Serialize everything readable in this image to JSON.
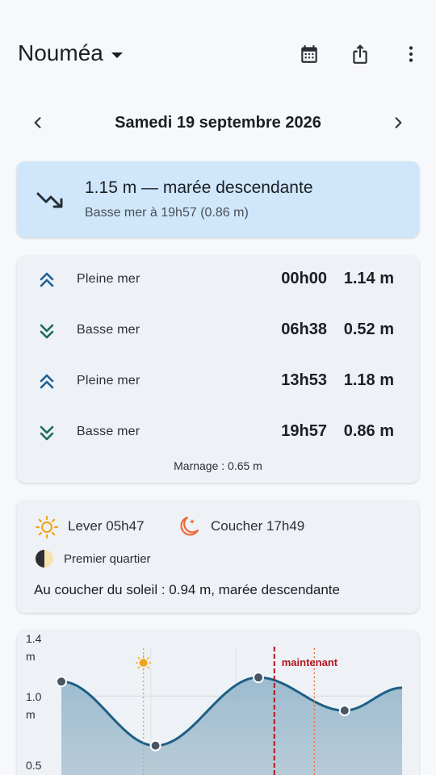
{
  "header": {
    "city": "Nouméa",
    "icons": {
      "calendar": "calendar-icon",
      "share": "share-icon",
      "menu": "more-vert-icon"
    }
  },
  "date_nav": {
    "prev_icon": "chevron-left-icon",
    "title": "Samedi 19 septembre 2026",
    "next_icon": "chevron-right-icon"
  },
  "status": {
    "icon": "trending-down-icon",
    "current": "1.15 m — marée descendante",
    "next": "Basse mer à 19h57 (0.86 m)"
  },
  "tides": {
    "rows": [
      {
        "type": "high",
        "label": "Pleine mer",
        "time": "00h00",
        "height": "1.14 m"
      },
      {
        "type": "low",
        "label": "Basse mer",
        "time": "06h38",
        "height": "0.52 m"
      },
      {
        "type": "high",
        "label": "Pleine mer",
        "time": "13h53",
        "height": "1.18 m"
      },
      {
        "type": "low",
        "label": "Basse mer",
        "time": "19h57",
        "height": "0.86 m"
      }
    ],
    "marnage": "Marnage : 0.65 m"
  },
  "sun": {
    "rise": "Lever 05h47",
    "set": "Coucher 17h49",
    "moon_phase": "Premier quartier",
    "sunset_tide": "Au coucher du soleil : 0.94 m, marée descendante"
  },
  "colors": {
    "status_bg": "#cfe6fb",
    "high_tide": "#1d5f96",
    "low_tide": "#1b6b5a",
    "curve": "#1f5f86",
    "now_marker": "#b3121b",
    "sun": "#f2a51a",
    "sunset": "#f06a3a"
  },
  "chart_data": {
    "type": "area",
    "y_tick_labels": [
      "1.4",
      "m",
      "1.0",
      "m",
      "0.5"
    ],
    "now_label": "maintenant",
    "ylim": [
      0.5,
      1.4
    ],
    "xlim": [
      0,
      24
    ],
    "x": [
      0,
      6.63,
      13.88,
      19.95,
      24
    ],
    "y": [
      1.14,
      0.52,
      1.18,
      0.86,
      1.08
    ],
    "extrema": [
      {
        "x": 0,
        "y": 1.14
      },
      {
        "x": 6.63,
        "y": 0.52
      },
      {
        "x": 13.88,
        "y": 1.18
      },
      {
        "x": 19.95,
        "y": 0.86
      }
    ],
    "sunrise_hour": 5.78,
    "sunset_hour": 17.82,
    "now_hour": 15.0,
    "grid": true
  }
}
